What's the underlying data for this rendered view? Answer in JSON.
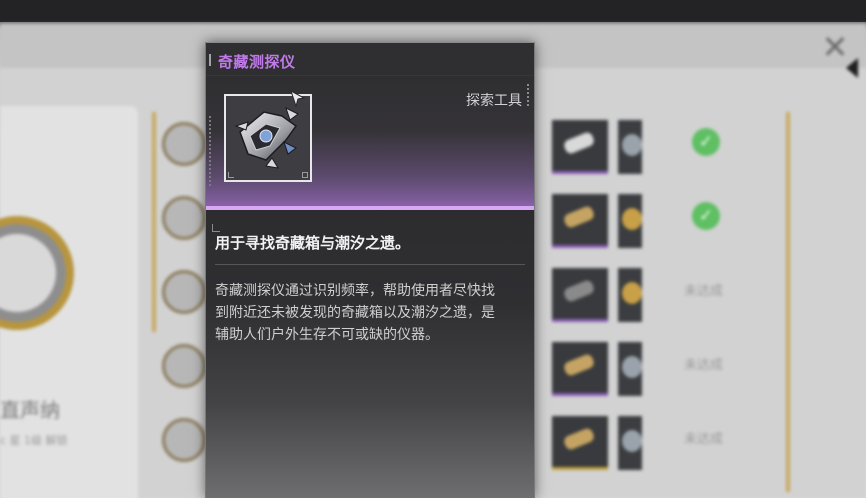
{
  "tooltip": {
    "title": "奇藏测探仪",
    "category": "探索工具",
    "summary": "用于寻找奇藏箱与潮汐之遗。",
    "description_lines": [
      "奇藏测探仪通过识别频率，帮助使用者尽快找",
      "到附近还未被发现的奇藏箱以及潮汐之遗，是",
      "辅助人们户外生存不可或缺的仪器。"
    ],
    "icon": "drone-scanner-icon",
    "accent_color": "#c07ae8",
    "rarity_color": "#d8a8f6"
  },
  "background": {
    "close_icon": "close-x-icon",
    "left_panel": {
      "title": "直声纳",
      "subtitle": "c 星 1级 解锁"
    },
    "rows": [
      {
        "status_icon": "check-icon",
        "status": ""
      },
      {
        "status_icon": "check-icon",
        "status": ""
      },
      {
        "status_icon": "",
        "status": "未达成"
      },
      {
        "status_icon": "",
        "status": "未达成"
      },
      {
        "status_icon": "",
        "status": "未达成"
      }
    ]
  }
}
